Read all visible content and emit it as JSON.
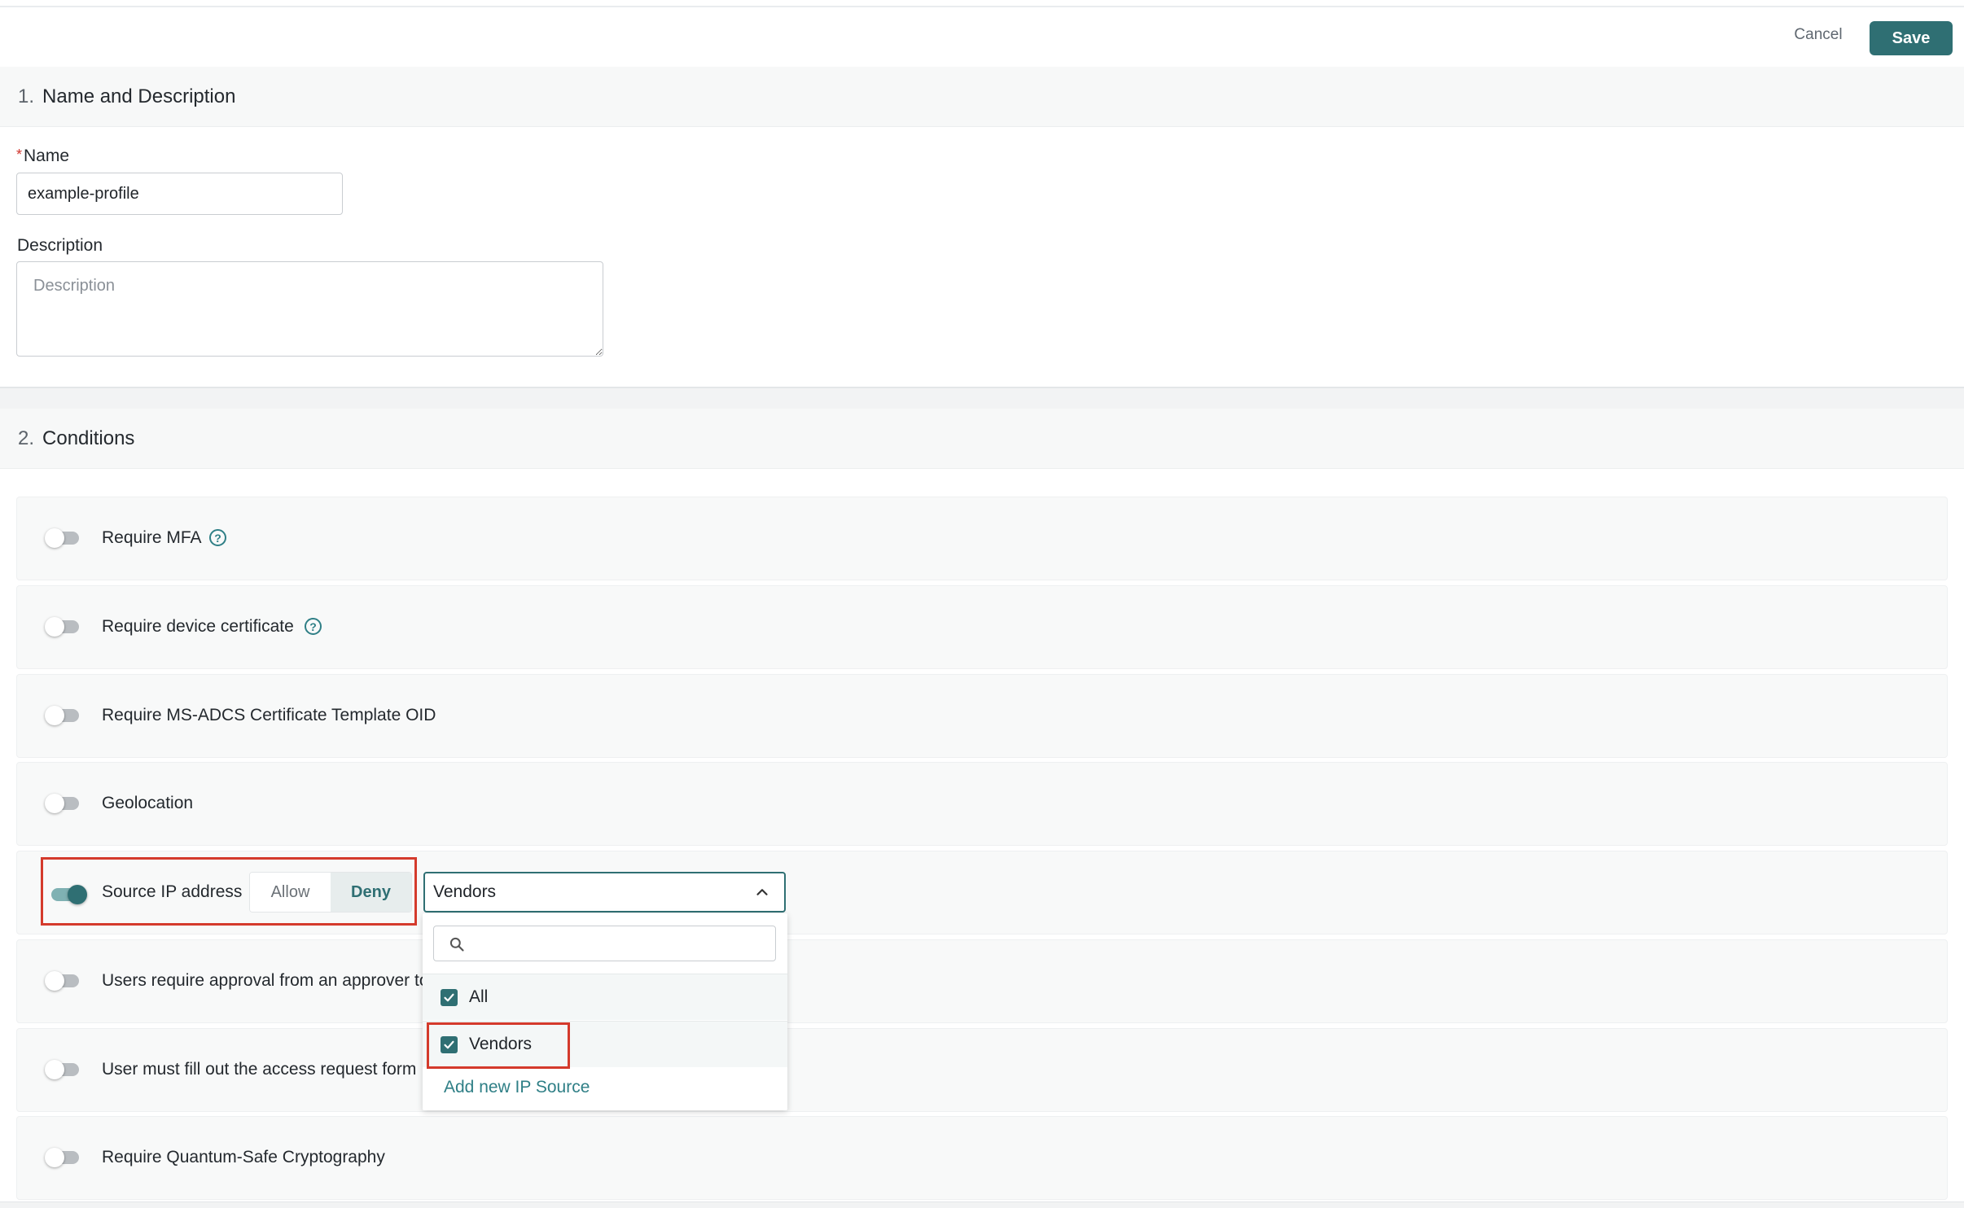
{
  "toolbar": {
    "cancel_label": "Cancel",
    "save_label": "Save"
  },
  "section1": {
    "number": "1.",
    "title": "Name and Description",
    "name_required_mark": "*",
    "name_label": "Name",
    "name_value": "example-profile",
    "description_label": "Description",
    "description_placeholder": "Description"
  },
  "section2": {
    "number": "2.",
    "title": "Conditions",
    "rows": [
      {
        "label": "Require MFA",
        "enabled": false,
        "help": true
      },
      {
        "label": "Require device certificate",
        "enabled": false,
        "help": true
      },
      {
        "label": "Require MS-ADCS Certificate Template OID",
        "enabled": false
      },
      {
        "label": "Geolocation",
        "enabled": false
      },
      {
        "label": "Source IP address",
        "enabled": true
      },
      {
        "label": "Users require approval from an approver to",
        "enabled": false
      },
      {
        "label": "User must fill out the access request form",
        "enabled": false
      },
      {
        "label": "Require Quantum-Safe Cryptography",
        "enabled": false
      }
    ]
  },
  "source_ip": {
    "allow_label": "Allow",
    "deny_label": "Deny",
    "selected_mode": "Deny",
    "selected_value": "Vendors",
    "dropdown": {
      "search_value": "",
      "options": [
        {
          "label": "All",
          "checked": true
        },
        {
          "label": "Vendors",
          "checked": true
        }
      ],
      "add_label": "Add new IP Source"
    }
  },
  "colors": {
    "accent": "#2f6f73",
    "highlight": "#d43a2c",
    "link": "#2f7f86"
  },
  "icons": {
    "help": "question-circle-icon",
    "chevron": "chevron-up-icon",
    "search": "search-icon",
    "check": "check-icon"
  }
}
